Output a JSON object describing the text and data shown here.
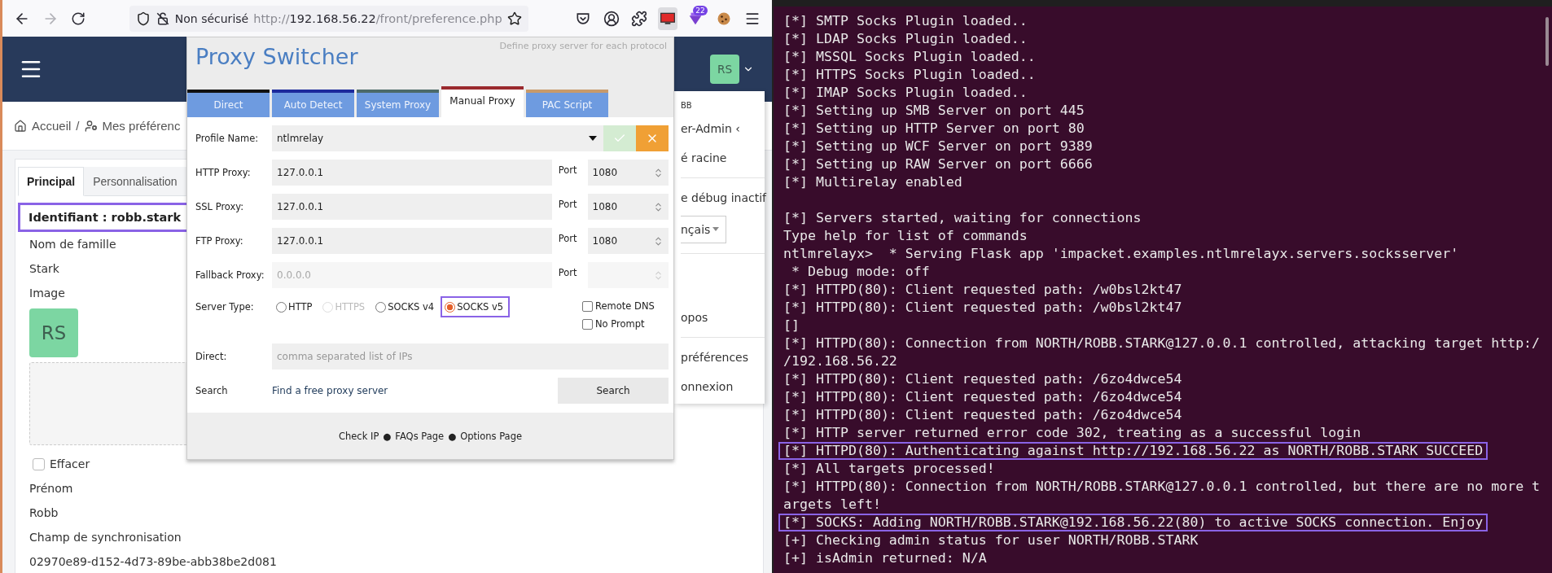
{
  "browser": {
    "forward_disabled": true,
    "security_label": "Non sécurisé",
    "url": {
      "scheme": "http://",
      "host": "192.168.56.22",
      "path": "/front/preference.php"
    },
    "extension_badge": "22"
  },
  "app_header": {
    "avatar": "RS"
  },
  "breadcrumb": {
    "items": [
      "Accueil",
      "Mes préférenc"
    ],
    "separator": "/"
  },
  "preferences": {
    "tabs": [
      {
        "label": "Principal",
        "selected": true
      },
      {
        "label": "Personnalisation",
        "selected": false
      }
    ],
    "identifiant": {
      "text": "Identifiant : robb.stark",
      "highlighted": true
    },
    "fields": [
      {
        "kind": "text",
        "label": "Nom de famille",
        "value": "Stark"
      },
      {
        "kind": "image",
        "label": "Image",
        "avatar": "RS"
      },
      {
        "kind": "checkbox",
        "label": "Effacer",
        "checked": false
      },
      {
        "kind": "text",
        "label": "Prénom",
        "value": "Robb"
      },
      {
        "kind": "text",
        "label": "Champ de synchronisation",
        "value": "02970e89-d152-4d73-89be-abb38be2d081"
      }
    ]
  },
  "user_menu": {
    "sections": [
      {
        "items": [
          {
            "kind": "caption",
            "text": "BB"
          },
          {
            "kind": "item",
            "text": "er-Admin ‹"
          },
          {
            "kind": "item",
            "text": "é racine"
          }
        ]
      },
      {
        "items": [
          {
            "kind": "item",
            "text": "e débug inactif"
          },
          {
            "kind": "select",
            "text": "nçais"
          }
        ]
      },
      {
        "items": [
          {
            "kind": "item",
            "text": "opos"
          }
        ]
      },
      {
        "items": [
          {
            "kind": "item",
            "text": "préférences"
          },
          {
            "kind": "item",
            "text": "onnexion"
          }
        ]
      }
    ]
  },
  "proxy_switcher": {
    "title": "Proxy Switcher",
    "subtitle": "Define proxy server for each protocol",
    "tabs": [
      {
        "label": "Direct",
        "selected": false,
        "color": "#111111"
      },
      {
        "label": "Auto Detect",
        "selected": false,
        "color": "#1c2a9c"
      },
      {
        "label": "System Proxy",
        "selected": false,
        "color": "#4c6a68"
      },
      {
        "label": "Manual Proxy",
        "selected": true,
        "color": "#9a2a2e"
      },
      {
        "label": "PAC Script",
        "selected": false,
        "color": "#c89a6a"
      }
    ],
    "profile": {
      "label": "Profile Name:",
      "value": "ntlmrelay"
    },
    "proxies": [
      {
        "label": "HTTP Proxy:",
        "value": "127.0.0.1",
        "port_label": "Port",
        "port": "1080",
        "disabled": false
      },
      {
        "label": "SSL Proxy:",
        "value": "127.0.0.1",
        "port_label": "Port",
        "port": "1080",
        "disabled": false
      },
      {
        "label": "FTP Proxy:",
        "value": "127.0.0.1",
        "port_label": "Port",
        "port": "1080",
        "disabled": false
      },
      {
        "label": "Fallback Proxy:",
        "placeholder": "0.0.0.0",
        "port_label": "Port",
        "disabled": true
      }
    ],
    "server_type": {
      "label": "Server Type:",
      "options": [
        {
          "label": "HTTP",
          "selected": false,
          "disabled": false,
          "highlighted": false
        },
        {
          "label": "HTTPS",
          "selected": false,
          "disabled": true,
          "highlighted": false
        },
        {
          "label": "SOCKS v4",
          "selected": false,
          "disabled": false,
          "highlighted": false
        },
        {
          "label": "SOCKS v5",
          "selected": true,
          "disabled": false,
          "highlighted": true
        }
      ]
    },
    "options": [
      {
        "label": "Remote DNS",
        "checked": false
      },
      {
        "label": "No Prompt",
        "checked": false
      }
    ],
    "direct": {
      "label": "Direct:",
      "placeholder": "comma separated list of IPs"
    },
    "search": {
      "label": "Search",
      "link": "Find a free proxy server",
      "button": "Search"
    },
    "footer": {
      "links": [
        "Check IP",
        "FAQs Page",
        "Options Page"
      ],
      "separator": "●"
    }
  },
  "terminal": {
    "lines": [
      {
        "kind": "text",
        "text": "[*] SMTP Socks Plugin loaded..",
        "highlighted": false
      },
      {
        "kind": "text",
        "text": "[*] LDAP Socks Plugin loaded..",
        "highlighted": false
      },
      {
        "kind": "text",
        "text": "[*] MSSQL Socks Plugin loaded..",
        "highlighted": false
      },
      {
        "kind": "text",
        "text": "[*] HTTPS Socks Plugin loaded..",
        "highlighted": false
      },
      {
        "kind": "text",
        "text": "[*] IMAP Socks Plugin loaded..",
        "highlighted": false
      },
      {
        "kind": "text",
        "text": "[*] Setting up SMB Server on port 445",
        "highlighted": false
      },
      {
        "kind": "text",
        "text": "[*] Setting up HTTP Server on port 80",
        "highlighted": false
      },
      {
        "kind": "text",
        "text": "[*] Setting up WCF Server on port 9389",
        "highlighted": false
      },
      {
        "kind": "text",
        "text": "[*] Setting up RAW Server on port 6666",
        "highlighted": false
      },
      {
        "kind": "text",
        "text": "[*] Multirelay enabled",
        "highlighted": false
      },
      {
        "kind": "blank"
      },
      {
        "kind": "text",
        "text": "[*] Servers started, waiting for connections",
        "highlighted": false
      },
      {
        "kind": "text",
        "text": "Type help for list of commands",
        "highlighted": false
      },
      {
        "kind": "text",
        "text": "ntlmrelayx>  * Serving Flask app 'impacket.examples.ntlmrelayx.servers.socksserver'",
        "highlighted": false
      },
      {
        "kind": "text",
        "text": " * Debug mode: off",
        "highlighted": false
      },
      {
        "kind": "text",
        "text": "[*] HTTPD(80): Client requested path: /w0bsl2kt47",
        "highlighted": false
      },
      {
        "kind": "text",
        "text": "[*] HTTPD(80): Client requested path: /w0bsl2kt47",
        "highlighted": false
      },
      {
        "kind": "text",
        "text": "[]",
        "highlighted": false
      },
      {
        "kind": "text",
        "text": "[*] HTTPD(80): Connection from NORTH/ROBB.STARK@127.0.0.1 controlled, attacking target http:/",
        "highlighted": false
      },
      {
        "kind": "text",
        "text": "/192.168.56.22",
        "highlighted": false
      },
      {
        "kind": "text",
        "text": "[*] HTTPD(80): Client requested path: /6zo4dwce54",
        "highlighted": false
      },
      {
        "kind": "text",
        "text": "[*] HTTPD(80): Client requested path: /6zo4dwce54",
        "highlighted": false
      },
      {
        "kind": "text",
        "text": "[*] HTTPD(80): Client requested path: /6zo4dwce54",
        "highlighted": false
      },
      {
        "kind": "text",
        "text": "[*] HTTP server returned error code 302, treating as a successful login",
        "highlighted": false
      },
      {
        "kind": "text",
        "text": "[*] HTTPD(80): Authenticating against http://192.168.56.22 as NORTH/ROBB.STARK SUCCEED",
        "highlighted": true
      },
      {
        "kind": "text",
        "text": "[*] All targets processed!",
        "highlighted": false
      },
      {
        "kind": "text",
        "text": "[*] HTTPD(80): Connection from NORTH/ROBB.STARK@127.0.0.1 controlled, but there are no more t",
        "highlighted": false
      },
      {
        "kind": "text",
        "text": "argets left!",
        "highlighted": false
      },
      {
        "kind": "text",
        "text": "[*] SOCKS: Adding NORTH/ROBB.STARK@192.168.56.22(80) to active SOCKS connection. Enjoy",
        "highlighted": true
      },
      {
        "kind": "text",
        "text": "[+] Checking admin status for user NORTH/ROBB.STARK",
        "highlighted": false
      },
      {
        "kind": "text",
        "text": "[+] isAdmin returned: N/A",
        "highlighted": false
      }
    ]
  }
}
